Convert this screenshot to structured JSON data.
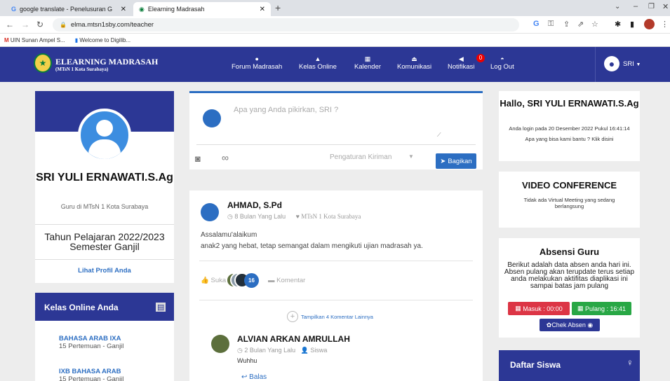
{
  "browser": {
    "tabs": [
      {
        "favicon": "G",
        "title": "google translate - Penelusuran G"
      },
      {
        "title": "Elearning Madrasah"
      }
    ],
    "url": "elma.mtsn1sby.com/teacher",
    "bookmarks": [
      "UIN Sunan Ampel S...",
      "Welcome to Digilib..."
    ]
  },
  "nav": {
    "brand": "ELEARNING MADRASAH",
    "brand_sub": "(MTsN 1 Kota Surabaya)",
    "items": [
      "Forum Madrasah",
      "Kelas Online",
      "Kalender",
      "Komunikasi",
      "Notifikasi",
      "Log Out"
    ],
    "notif_count": "0",
    "user": "SRI"
  },
  "profile": {
    "name": "SRI YULI ERNAWATI.S.Ag",
    "role": "Guru di MTsN 1 Kota Surabaya",
    "year": "Tahun Pelajaran 2022/2023",
    "semester": "Semester Ganjil",
    "profile_link": "Lihat Profil Anda"
  },
  "kelas": {
    "title": "Kelas Online Anda",
    "items": [
      {
        "name": "BAHASA ARAB IXA",
        "sub": "15 Pertemuan - Ganjil"
      },
      {
        "name": "IXB BAHASA ARAB",
        "sub": "15 Pertemuan - Ganjil"
      }
    ]
  },
  "composer": {
    "placeholder": "Apa yang Anda pikirkan, SRI ?",
    "setting": "Pengaturan Kiriman",
    "share": "Bagikan"
  },
  "post": {
    "author": "AHMAD, S.Pd",
    "time": "8 Bulan Yang Lalu",
    "school": "MTsN 1 Kota Surabaya",
    "line1": "Assalamu'alaikum",
    "line2": "anak2 yang hebat, tetap semangat dalam mengikuti ujian madrasah ya.",
    "like": "Suka",
    "like_count": "16",
    "comment": "Komentar",
    "more": "Tampilkan 4 Komentar Lainnya",
    "comment_author": "ALVIAN ARKAN AMRULLAH",
    "comment_time": "2 Bulan Yang Lalu",
    "comment_role": "Siswa",
    "comment_text": "Wuhhu",
    "reply": "Balas"
  },
  "hello": {
    "title": "Hallo, SRI YULI ERNAWATI.S.Ag",
    "login": "Anda login pada 20 Desember 2022 Pukul 16:41:14",
    "help": "Apa yang bisa kami bantu ? Klik disini"
  },
  "video": {
    "title": "VIDEO CONFERENCE",
    "text": "Tidak ada Virtual Meeting yang sedang berlangsung"
  },
  "absensi": {
    "title": "Absensi Guru",
    "text": "Berikut adalah data absen anda hari ini. Absen pulang akan terupdate terus setiap anda melakukan aktifitas diaplikasi ini sampai batas jam pulang",
    "masuk": "Masuk : 00:00",
    "pulang": "Pulang : 16:41",
    "chek": "Chek Absen"
  },
  "siswa": {
    "title": "Daftar Siswa"
  },
  "colors": {
    "navy": "#2c3795",
    "blue": "#2c6ec2",
    "red": "#dc3545",
    "green": "#28a745"
  }
}
